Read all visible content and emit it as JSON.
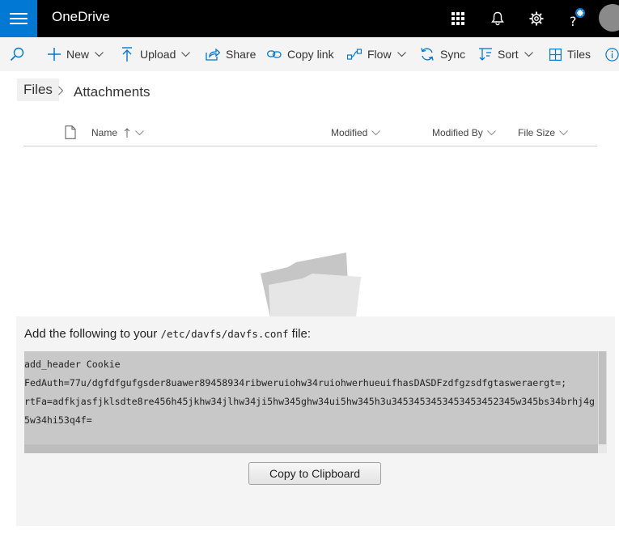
{
  "app": {
    "title": "OneDrive"
  },
  "commands": {
    "new": "New",
    "upload": "Upload",
    "share": "Share",
    "copy_link": "Copy link",
    "flow": "Flow",
    "sync": "Sync",
    "sort": "Sort",
    "tiles": "Tiles"
  },
  "breadcrumb": {
    "root": "Files",
    "current": "Attachments"
  },
  "columns": {
    "name": "Name",
    "modified": "Modified",
    "modified_by": "Modified By",
    "file_size": "File Size"
  },
  "dialog": {
    "title_prefix": "Add the following to your",
    "title_path": "/etc/davfs/davfs.conf",
    "title_suffix": "file:",
    "code": "add_header Cookie\nFedAuth=77u/dgfdfgufgsder8uawer89458934ribweruiohw34ruiohwerhueuifhasDASDFzdfgzsdfgtasweraergt=;\nrtFa=adfkjasfjklsdte8re456h45jkhw34jlhw34ji5hw345ghw34ui5hw345h3u3453453453453453452345w345bs34brhj4g\n5w34hi53q4f=",
    "copy_button": "Copy to Clipboard"
  },
  "colors": {
    "suite_bar": "#000000",
    "accent": "#0078d4",
    "command_bar": "#f4f4f4",
    "code_bg": "#c8c8c8"
  },
  "icons": [
    "waffle-menu-icon",
    "app-launcher-icon",
    "bell-icon",
    "gear-icon",
    "help-icon",
    "search-icon",
    "plus-icon",
    "upload-arrow-icon",
    "share-icon",
    "link-icon",
    "flow-icon",
    "sync-icon",
    "sort-icon",
    "tiles-icon",
    "info-icon",
    "chevron-right-icon",
    "document-icon",
    "sort-up-arrow-icon",
    "chevron-down-icon",
    "empty-folder-illustration"
  ]
}
